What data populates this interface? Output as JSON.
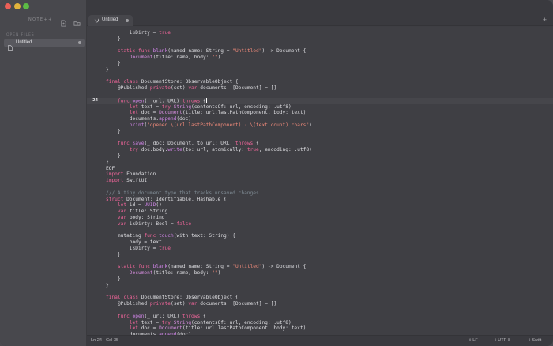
{
  "sidebar": {
    "brand": "NOTE++",
    "section_label": "OPEN FILES",
    "files": [
      {
        "name": "Untitled",
        "icon": "document-icon",
        "modified": true
      }
    ]
  },
  "tabs": [
    {
      "title": "Untitled",
      "icon": "swift-icon",
      "modified": true
    }
  ],
  "editor": {
    "current_line": 24,
    "lines": [
      {
        "n": "",
        "t": [
          [
            "plain",
            "        isDirty = "
          ],
          [
            "kw",
            "true"
          ]
        ]
      },
      {
        "n": "",
        "t": [
          [
            "plain",
            "    }"
          ]
        ]
      },
      {
        "n": "",
        "t": []
      },
      {
        "n": "",
        "t": [
          [
            "kw",
            "    static func "
          ],
          [
            "fn",
            "blank"
          ],
          [
            "plain",
            "(named name: String = "
          ],
          [
            "str",
            "\"Untitled\""
          ],
          [
            "plain",
            ") -> Document {"
          ]
        ]
      },
      {
        "n": "",
        "t": [
          [
            "type",
            "        Document"
          ],
          [
            "plain",
            "(title: name, body: "
          ],
          [
            "str",
            "\"\""
          ],
          [
            "plain",
            ")"
          ]
        ]
      },
      {
        "n": "",
        "t": [
          [
            "plain",
            "    }"
          ]
        ]
      },
      {
        "n": "",
        "t": [
          [
            "plain",
            "}"
          ]
        ]
      },
      {
        "n": "",
        "t": []
      },
      {
        "n": "",
        "t": [
          [
            "kw",
            "final class "
          ],
          [
            "plain",
            "DocumentStore: ObservableObject {"
          ]
        ]
      },
      {
        "n": "",
        "t": [
          [
            "plain",
            "    @Published "
          ],
          [
            "kw",
            "private"
          ],
          [
            "plain",
            "(set) "
          ],
          [
            "kw",
            "var"
          ],
          [
            "plain",
            " documents: [Document] = []"
          ]
        ]
      },
      {
        "n": "",
        "t": []
      },
      {
        "n": "24",
        "t": [
          [
            "kw",
            "    func "
          ],
          [
            "fn",
            "open"
          ],
          [
            "plain",
            "(_ url: URL) "
          ],
          [
            "kw",
            "throws"
          ],
          [
            "plain",
            " {"
          ]
        ],
        "current": true,
        "cursor": true
      },
      {
        "n": "",
        "t": [
          [
            "kw",
            "        let "
          ],
          [
            "plain",
            "text = "
          ],
          [
            "kw",
            "try "
          ],
          [
            "type",
            "String"
          ],
          [
            "plain",
            "(contentsOf: url, encoding: .utf8)"
          ]
        ]
      },
      {
        "n": "",
        "t": [
          [
            "kw",
            "        let "
          ],
          [
            "plain",
            "doc = "
          ],
          [
            "type",
            "Document"
          ],
          [
            "plain",
            "(title: url.lastPathComponent, body: text)"
          ]
        ]
      },
      {
        "n": "",
        "t": [
          [
            "plain",
            "        documents."
          ],
          [
            "fn",
            "append"
          ],
          [
            "plain",
            "(doc)"
          ]
        ]
      },
      {
        "n": "",
        "t": [
          [
            "fn",
            "        print"
          ],
          [
            "plain",
            "("
          ],
          [
            "str",
            "\"opened \\(url.lastPathComponent) · \\(text.count) chars\""
          ],
          [
            "plain",
            ")"
          ]
        ]
      },
      {
        "n": "",
        "t": [
          [
            "plain",
            "    }"
          ]
        ]
      },
      {
        "n": "",
        "t": []
      },
      {
        "n": "",
        "t": [
          [
            "kw",
            "    func "
          ],
          [
            "fn",
            "save"
          ],
          [
            "plain",
            "(_ doc: Document, to url: URL) "
          ],
          [
            "kw",
            "throws"
          ],
          [
            "plain",
            " {"
          ]
        ]
      },
      {
        "n": "",
        "t": [
          [
            "kw",
            "        try "
          ],
          [
            "plain",
            "doc.body."
          ],
          [
            "fn",
            "write"
          ],
          [
            "plain",
            "(to: url, atomically: "
          ],
          [
            "kw",
            "true"
          ],
          [
            "plain",
            ", encoding: .utf8)"
          ]
        ]
      },
      {
        "n": "",
        "t": [
          [
            "plain",
            "    }"
          ]
        ]
      },
      {
        "n": "",
        "t": [
          [
            "plain",
            "}"
          ]
        ]
      },
      {
        "n": "",
        "t": [
          [
            "plain",
            "EOF"
          ]
        ]
      },
      {
        "n": "",
        "t": [
          [
            "kw",
            "import "
          ],
          [
            "plain",
            "Foundation"
          ]
        ]
      },
      {
        "n": "",
        "t": [
          [
            "kw",
            "import "
          ],
          [
            "plain",
            "SwiftUI"
          ]
        ]
      },
      {
        "n": "",
        "t": []
      },
      {
        "n": "",
        "t": [
          [
            "com",
            "/// A tiny document type that tracks unsaved changes."
          ]
        ]
      },
      {
        "n": "",
        "t": [
          [
            "kw",
            "struct "
          ],
          [
            "plain",
            "Document: Identifiable, Hashable {"
          ]
        ]
      },
      {
        "n": "",
        "t": [
          [
            "kw",
            "    let "
          ],
          [
            "plain",
            "id = "
          ],
          [
            "fn",
            "UUID"
          ],
          [
            "plain",
            "()"
          ]
        ]
      },
      {
        "n": "",
        "t": [
          [
            "kw",
            "    var "
          ],
          [
            "plain",
            "title: String"
          ]
        ]
      },
      {
        "n": "",
        "t": [
          [
            "kw",
            "    var "
          ],
          [
            "plain",
            "body: String"
          ]
        ]
      },
      {
        "n": "",
        "t": [
          [
            "kw",
            "    var "
          ],
          [
            "plain",
            "isDirty: Bool = "
          ],
          [
            "kw",
            "false"
          ]
        ]
      },
      {
        "n": "",
        "t": []
      },
      {
        "n": "",
        "t": [
          [
            "plain",
            "    mutating "
          ],
          [
            "kw",
            "func "
          ],
          [
            "fn",
            "touch"
          ],
          [
            "plain",
            "(with text: String) {"
          ]
        ]
      },
      {
        "n": "",
        "t": [
          [
            "plain",
            "        body = text"
          ]
        ]
      },
      {
        "n": "",
        "t": [
          [
            "plain",
            "        isDirty = "
          ],
          [
            "kw",
            "true"
          ]
        ]
      },
      {
        "n": "",
        "t": [
          [
            "plain",
            "    }"
          ]
        ]
      },
      {
        "n": "",
        "t": []
      },
      {
        "n": "",
        "t": [
          [
            "kw",
            "    static func "
          ],
          [
            "fn",
            "blank"
          ],
          [
            "plain",
            "(named name: String = "
          ],
          [
            "str",
            "\"Untitled\""
          ],
          [
            "plain",
            ") -> Document {"
          ]
        ]
      },
      {
        "n": "",
        "t": [
          [
            "type",
            "        Document"
          ],
          [
            "plain",
            "(title: name, body: "
          ],
          [
            "str",
            "\"\""
          ],
          [
            "plain",
            ")"
          ]
        ]
      },
      {
        "n": "",
        "t": [
          [
            "plain",
            "    }"
          ]
        ]
      },
      {
        "n": "",
        "t": [
          [
            "plain",
            "}"
          ]
        ]
      },
      {
        "n": "",
        "t": []
      },
      {
        "n": "",
        "t": [
          [
            "kw",
            "final class "
          ],
          [
            "plain",
            "DocumentStore: ObservableObject {"
          ]
        ]
      },
      {
        "n": "",
        "t": [
          [
            "plain",
            "    @Published "
          ],
          [
            "kw",
            "private"
          ],
          [
            "plain",
            "(set) "
          ],
          [
            "kw",
            "var"
          ],
          [
            "plain",
            " documents: [Document] = []"
          ]
        ]
      },
      {
        "n": "",
        "t": []
      },
      {
        "n": "",
        "t": [
          [
            "kw",
            "    func "
          ],
          [
            "fn",
            "open"
          ],
          [
            "plain",
            "(_ url: URL) "
          ],
          [
            "kw",
            "throws"
          ],
          [
            "plain",
            " {"
          ]
        ]
      },
      {
        "n": "",
        "t": [
          [
            "kw",
            "        let "
          ],
          [
            "plain",
            "text = "
          ],
          [
            "kw",
            "try "
          ],
          [
            "type",
            "String"
          ],
          [
            "plain",
            "(contentsOf: url, encoding: .utf8)"
          ]
        ]
      },
      {
        "n": "",
        "t": [
          [
            "kw",
            "        let "
          ],
          [
            "plain",
            "doc = "
          ],
          [
            "type",
            "Document"
          ],
          [
            "plain",
            "(title: url.lastPathComponent, body: text)"
          ]
        ]
      },
      {
        "n": "",
        "t": [
          [
            "plain",
            "        documents."
          ],
          [
            "fn",
            "append"
          ],
          [
            "plain",
            "(doc)"
          ]
        ]
      }
    ]
  },
  "statusbar": {
    "line_label": "Ln 24",
    "col_label": "Col 35",
    "line_ending": "LF",
    "encoding": "UTF-8",
    "language": "Swift"
  }
}
